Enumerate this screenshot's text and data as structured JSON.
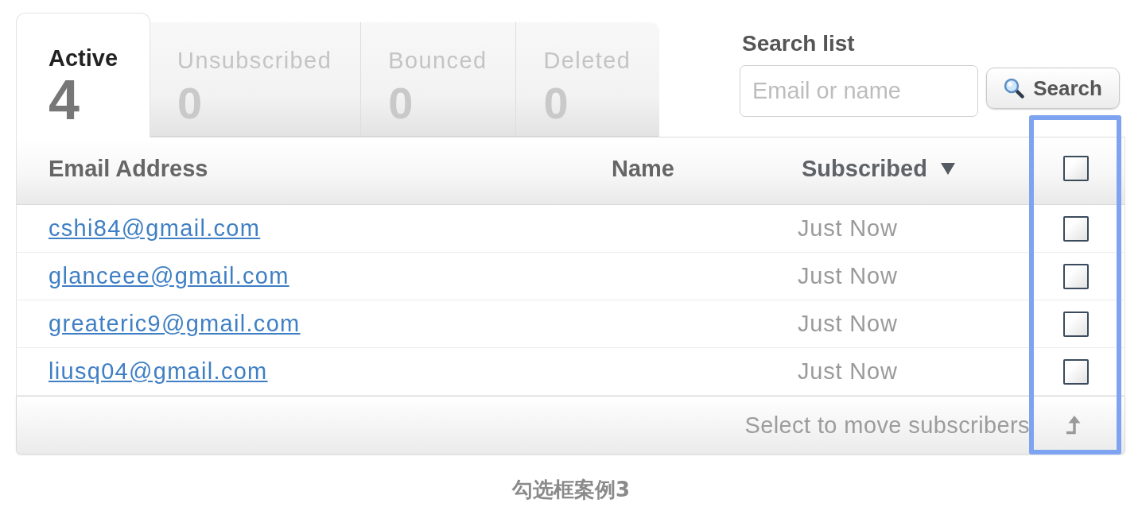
{
  "tabs": [
    {
      "label": "Active",
      "count": "4",
      "selected": true
    },
    {
      "label": "Unsubscribed",
      "count": "0",
      "selected": false
    },
    {
      "label": "Bounced",
      "count": "0",
      "selected": false
    },
    {
      "label": "Deleted",
      "count": "0",
      "selected": false
    }
  ],
  "search": {
    "label": "Search list",
    "placeholder": "Email or name",
    "button": "Search"
  },
  "table": {
    "columns": [
      {
        "label": "Email Address",
        "sorted": false
      },
      {
        "label": "Name",
        "sorted": false
      },
      {
        "label": "Subscribed",
        "sorted": true
      }
    ],
    "select_all_checked": false,
    "checkbox_column_highlighted": true,
    "rows": [
      {
        "email": "cshi84@gmail.com",
        "subscribed": "Just Now",
        "checked": false
      },
      {
        "email": "glanceee@gmail.com",
        "subscribed": "Just Now",
        "checked": false
      },
      {
        "email": "greateric9@gmail.com",
        "subscribed": "Just Now",
        "checked": false
      },
      {
        "email": "liusq04@gmail.com",
        "subscribed": "Just Now",
        "checked": false
      }
    ]
  },
  "footer": {
    "text": "Select to move subscribers"
  },
  "caption": "勾选框案例3"
}
